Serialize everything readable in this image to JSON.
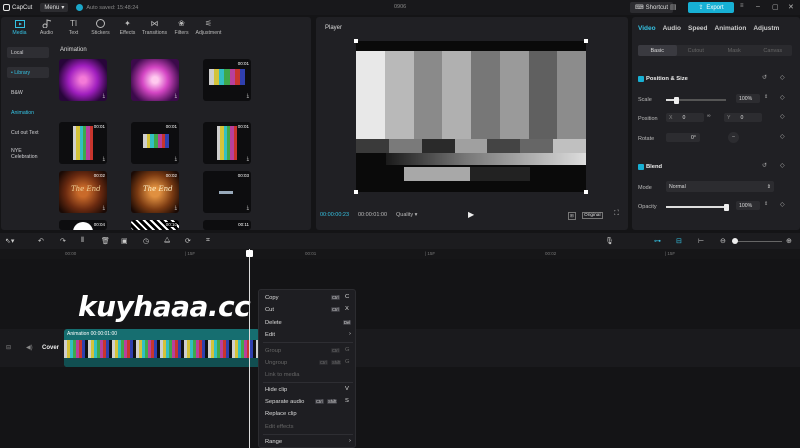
{
  "app": {
    "name": "CapCut",
    "menu_label": "Menu",
    "autosave": "Auto saved: 15:48:24",
    "project": "0906",
    "shortcut_label": "Shortcut",
    "export_label": "Export"
  },
  "media": {
    "tabs": [
      {
        "label": "Media",
        "icon": "media-icon"
      },
      {
        "label": "Audio",
        "icon": "audio-icon"
      },
      {
        "label": "Text",
        "icon": "text-icon"
      },
      {
        "label": "Stickers",
        "icon": "stickers-icon"
      },
      {
        "label": "Effects",
        "icon": "effects-icon"
      },
      {
        "label": "Transitions",
        "icon": "transitions-icon"
      },
      {
        "label": "Filters",
        "icon": "filters-icon"
      },
      {
        "label": "Adjustment",
        "icon": "adjustment-icon"
      }
    ],
    "sidebar": [
      "Local",
      "• Library",
      "B&W",
      "Animation",
      "Cut out Text",
      "NYE Celebration"
    ],
    "category_title": "Animation",
    "thumb_times": [
      "00:01",
      "00:01",
      "00:01",
      "00:01",
      "00:02",
      "00:02",
      "00:03",
      "00:04",
      "00:10",
      "00:11"
    ],
    "thumb_text": "The End"
  },
  "player": {
    "title": "Player",
    "current_time": "00:00:00:23",
    "total_time": "00:00:01:00",
    "quality_label": "Quality",
    "original_label": "Original"
  },
  "props": {
    "tabs": [
      "Video",
      "Audio",
      "Speed",
      "Animation",
      "Adjustm"
    ],
    "subtabs": [
      "Basic",
      "Cutout",
      "Mask",
      "Canvas"
    ],
    "position_size": "Position & Size",
    "scale_label": "Scale",
    "scale_value": "100%",
    "scale_level": 0.18,
    "position_label": "Position",
    "x_label": "X",
    "x_value": "0",
    "y_label": "Y",
    "y_value": "0",
    "rotate_label": "Rotate",
    "rotate_value": "0°",
    "blend_label": "Blend",
    "mode_label": "Mode",
    "mode_value": "Normal",
    "opacity_label": "Opacity",
    "opacity_value": "100%",
    "opacity_level": 1.0
  },
  "timeline": {
    "ruler": [
      "00:00",
      "| 15F",
      "00:01",
      "| 15F",
      "00:02",
      "| 15F"
    ],
    "cover_label": "Cover",
    "clip_label": "Animation   00:00:01:00",
    "watermark": "kuyhaaa.cc"
  },
  "context_menu": {
    "items": [
      {
        "label": "Copy",
        "keys": [
          "Ctrl",
          "C"
        ],
        "enabled": true
      },
      {
        "label": "Cut",
        "keys": [
          "Ctrl",
          "X"
        ],
        "enabled": true
      },
      {
        "label": "Delete",
        "keys": [
          "Del"
        ],
        "enabled": true
      },
      {
        "label": "Edit",
        "keys": [
          "›"
        ],
        "enabled": true
      },
      {
        "label": "Group",
        "keys": [
          "Ctrl",
          "G"
        ],
        "enabled": false
      },
      {
        "label": "Ungroup",
        "keys": [
          "Ctrl",
          "Shift",
          "G"
        ],
        "enabled": false
      },
      {
        "label": "Link to media",
        "keys": [],
        "enabled": false
      },
      {
        "label": "Hide clip",
        "keys": [
          "V"
        ],
        "enabled": true
      },
      {
        "label": "Separate audio",
        "keys": [
          "Ctrl",
          "Shift",
          "S"
        ],
        "enabled": true
      },
      {
        "label": "Replace clip",
        "keys": [],
        "enabled": true
      },
      {
        "label": "Edit effects",
        "keys": [],
        "enabled": false
      },
      {
        "label": "Range",
        "keys": [
          "›"
        ],
        "enabled": true
      }
    ]
  },
  "colors": {
    "accent": "#17b0d4",
    "clip": "#166e70",
    "panel": "#202024"
  }
}
